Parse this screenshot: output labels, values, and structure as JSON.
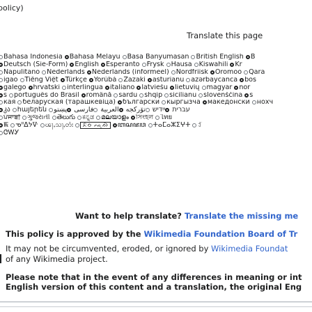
{
  "top": {
    "text": "policy)"
  },
  "translate": {
    "heading": "Translate this page"
  },
  "languages": {
    "lines": [
      [
        {
          "radio": "empty",
          "label": "Bahasa Indonesia"
        },
        {
          "radio": "filled",
          "label": "Bahasa Melayu"
        },
        {
          "radio": "empty",
          "label": "Basa Banyumasan"
        },
        {
          "radio": "empty",
          "label": "British English"
        },
        {
          "radio": "filled",
          "label": "B"
        }
      ],
      [
        {
          "radio": "filled",
          "label": "Deutsch (Sie-Form)"
        },
        {
          "radio": "filled",
          "label": "English"
        },
        {
          "radio": "filled",
          "label": "Esperanto"
        },
        {
          "radio": "empty",
          "label": "Frysk"
        },
        {
          "radio": "empty",
          "label": "Hausa"
        },
        {
          "radio": "empty",
          "label": "Kiswahili"
        },
        {
          "radio": "filled",
          "label": "Kr"
        }
      ],
      [
        {
          "radio": "empty",
          "label": "Napulitano"
        },
        {
          "radio": "empty",
          "label": "Nederlands"
        },
        {
          "radio": "filled",
          "label": "Nederlands (informeel)"
        },
        {
          "radio": "empty",
          "label": "Nordfriisk"
        },
        {
          "radio": "filled",
          "label": "Oromoo"
        },
        {
          "radio": "empty",
          "label": "Qara"
        }
      ],
      [
        {
          "radio": "empty",
          "label": "igao"
        },
        {
          "radio": "empty",
          "label": "Tiếng Việt"
        },
        {
          "radio": "filled",
          "label": "Türkçe"
        },
        {
          "radio": "filled",
          "label": "Yorùbá"
        },
        {
          "radio": "empty",
          "label": "Zazaki"
        },
        {
          "radio": "filled",
          "label": "asturianu"
        },
        {
          "radio": "empty",
          "label": "azərbaycanca"
        },
        {
          "radio": "filled",
          "label": "bos"
        }
      ],
      [
        {
          "radio": "filled",
          "label": "galego"
        },
        {
          "radio": "filled",
          "label": "hrvatski"
        },
        {
          "radio": "empty",
          "label": "interlingua"
        },
        {
          "radio": "filled",
          "label": "italiano"
        },
        {
          "radio": "filled",
          "label": "latviešu"
        },
        {
          "radio": "filled",
          "label": "lietuvių"
        },
        {
          "radio": "empty",
          "label": "magyar"
        },
        {
          "radio": "filled",
          "label": "nor"
        }
      ],
      [
        {
          "radio": "filled",
          "label": "s"
        },
        {
          "radio": "empty",
          "label": "português do Brasil"
        },
        {
          "radio": "filled",
          "label": "română"
        },
        {
          "radio": "empty",
          "label": "sardu"
        },
        {
          "radio": "empty",
          "label": "shqip"
        },
        {
          "radio": "empty",
          "label": "sicilianu"
        },
        {
          "radio": "empty",
          "label": "slovenščina"
        },
        {
          "radio": "filled",
          "label": "s"
        }
      ],
      [
        {
          "radio": "empty",
          "label": "кая"
        },
        {
          "radio": "empty",
          "label": "беларуская (тарашкевіца)"
        },
        {
          "radio": "filled",
          "label": "български"
        },
        {
          "radio": "empty",
          "label": "кыргызча"
        },
        {
          "radio": "filled",
          "label": "македонски"
        },
        {
          "radio": "empty",
          "label": "нохч"
        }
      ],
      [
        {
          "radio": "filled",
          "label": "კა"
        },
        {
          "radio": "empty",
          "label": "հայերեն"
        },
        {
          "radio": "empty",
          "label": "עברית"
        },
        {
          "radio": "filled",
          "label": "ייִדיש"
        },
        {
          "radio": "empty",
          "label": "تۆرکجه"
        },
        {
          "radio": "filled",
          "label": "العربية"
        },
        {
          "radio": "empty",
          "label": "فارسی"
        },
        {
          "radio": "filled",
          "label": "پښتو"
        }
      ],
      [
        {
          "radio": "empty",
          "label": "ਪੰਜਾਬੀ"
        },
        {
          "radio": "empty",
          "label": "ગુજરાતી"
        },
        {
          "radio": "empty",
          "label": "తెలుగు"
        },
        {
          "radio": "empty",
          "label": "ಕನ್ನಡ"
        },
        {
          "radio": "empty",
          "label": "മലയാളം"
        },
        {
          "radio": "filled",
          "label": "সিংহল"
        },
        {
          "radio": "empty",
          "label": "ไทย"
        }
      ],
      [
        {
          "radio": "filled",
          "label": "ꯃꯩ"
        },
        {
          "radio": "empty",
          "label": "ᓀᐦᐃᔭᐍ"
        },
        {
          "radio": "empty",
          "label": "ၽႃႇသႃႇတႆး"
        },
        {
          "radio": "empty",
          "label": "ᨅᨔ ᨕᨘᨁᨗ",
          "boxed": true
        },
        {
          "radio": "filled",
          "label": "ꦧꦱꦗꦮ"
        },
        {
          "radio": "empty",
          "label": "ⵜⴰⵎⴰⵣⵉⵖⵜ"
        },
        {
          "radio": "empty",
          "label": "ꆇ"
        }
      ],
      [
        {
          "radio": "empty",
          "label": "ᏣᎳᎩ"
        }
      ]
    ]
  },
  "help": {
    "prefix": "Want to help translate?",
    "link": "Translate the missing me"
  },
  "support": {
    "prefix": "This policy is approved by the",
    "link": "Wikimedia Foundation Board of Tr"
  },
  "circumvent": {
    "prefix": "It may not be circumvented, eroded, or ignored by",
    "link": "Wikimedia Foundat"
  },
  "project": {
    "text": "of any Wikimedia project."
  },
  "note": {
    "line1": "Please note that in the event of any differences in meaning or int",
    "line2": "English version of this content and a translation, the original Eng"
  }
}
